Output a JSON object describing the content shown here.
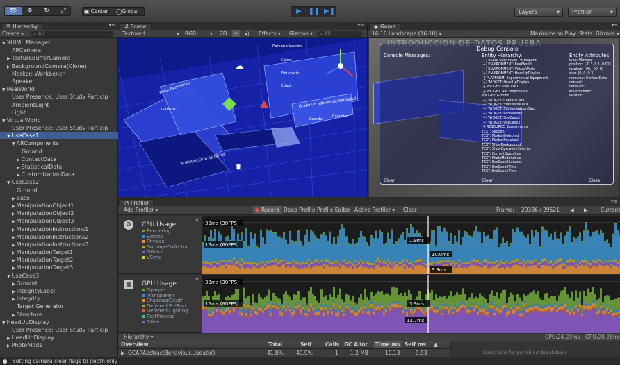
{
  "toolbar": {
    "center": "Center",
    "global": "Global",
    "layers": "Layers",
    "layout": "Profiler"
  },
  "hierarchy": {
    "tab": "Hierarchy",
    "create": "Create",
    "search": "All",
    "items": [
      {
        "label": "XUIML Manager",
        "indent": 0,
        "arrow": "▼",
        "sel": false
      },
      {
        "label": "ARCamera",
        "indent": 2,
        "arrow": "",
        "sel": false
      },
      {
        "label": "TextureBufferCamera",
        "indent": 1,
        "arrow": "▶",
        "sel": false
      },
      {
        "label": "BackgroundCamera(Clone)",
        "indent": 1,
        "arrow": "▶",
        "sel": false
      },
      {
        "label": "Marker: Workbench",
        "indent": 2,
        "arrow": "",
        "sel": false
      },
      {
        "label": "Speaker",
        "indent": 2,
        "arrow": "",
        "sel": false
      },
      {
        "label": "RealWorld",
        "indent": 0,
        "arrow": "▼",
        "sel": false
      },
      {
        "label": "User Presence: User Study Particip",
        "indent": 2,
        "arrow": "",
        "sel": false
      },
      {
        "label": "AmbientLight",
        "indent": 2,
        "arrow": "",
        "sel": false
      },
      {
        "label": "Light",
        "indent": 2,
        "arrow": "",
        "sel": false
      },
      {
        "label": "VirtualWorld",
        "indent": 0,
        "arrow": "▼",
        "sel": false
      },
      {
        "label": "User Presence: User Study Particip",
        "indent": 2,
        "arrow": "",
        "sel": false
      },
      {
        "label": "UseCase1",
        "indent": 1,
        "arrow": "▼",
        "sel": true
      },
      {
        "label": "ARComponents",
        "indent": 2,
        "arrow": "▼",
        "sel": false
      },
      {
        "label": "Ground",
        "indent": 4,
        "arrow": "",
        "sel": false
      },
      {
        "label": "ContactData",
        "indent": 3,
        "arrow": "▶",
        "sel": false
      },
      {
        "label": "StatisticalData",
        "indent": 3,
        "arrow": "▶",
        "sel": false
      },
      {
        "label": "CustomizationData",
        "indent": 3,
        "arrow": "▶",
        "sel": false
      },
      {
        "label": "UseCase2",
        "indent": 1,
        "arrow": "▼",
        "sel": false
      },
      {
        "label": "Ground",
        "indent": 3,
        "arrow": "",
        "sel": false
      },
      {
        "label": "Base",
        "indent": 2,
        "arrow": "▶",
        "sel": false
      },
      {
        "label": "ManipulationObject1",
        "indent": 2,
        "arrow": "▶",
        "sel": false
      },
      {
        "label": "ManipulationObject2",
        "indent": 2,
        "arrow": "▶",
        "sel": false
      },
      {
        "label": "ManipulationObject3",
        "indent": 2,
        "arrow": "▶",
        "sel": false
      },
      {
        "label": "ManipulationInstructions1",
        "indent": 2,
        "arrow": "▶",
        "sel": false
      },
      {
        "label": "ManipulationInstructions2",
        "indent": 2,
        "arrow": "▶",
        "sel": false
      },
      {
        "label": "ManipulationInstructions3",
        "indent": 2,
        "arrow": "▶",
        "sel": false
      },
      {
        "label": "ManipulationTarget1",
        "indent": 2,
        "arrow": "▶",
        "sel": false
      },
      {
        "label": "ManipulationTarget2",
        "indent": 2,
        "arrow": "▶",
        "sel": false
      },
      {
        "label": "ManipulationTarget3",
        "indent": 2,
        "arrow": "▶",
        "sel": false
      },
      {
        "label": "UseCase3",
        "indent": 1,
        "arrow": "▼",
        "sel": false
      },
      {
        "label": "Ground",
        "indent": 2,
        "arrow": "▶",
        "sel": false
      },
      {
        "label": "IntegrityLabel",
        "indent": 2,
        "arrow": "▶",
        "sel": false
      },
      {
        "label": "Integrity",
        "indent": 2,
        "arrow": "▶",
        "sel": false
      },
      {
        "label": "Target Generator",
        "indent": 3,
        "arrow": "",
        "sel": false
      },
      {
        "label": "Structure",
        "indent": 2,
        "arrow": "▶",
        "sel": false
      },
      {
        "label": "HeadUpDisplay",
        "indent": 0,
        "arrow": "▼",
        "sel": false
      },
      {
        "label": "User Presence: User Study Particip",
        "indent": 2,
        "arrow": "",
        "sel": false
      },
      {
        "label": "HeadUpDisplay",
        "indent": 1,
        "arrow": "▶",
        "sel": false
      },
      {
        "label": "PhotoMode",
        "indent": 1,
        "arrow": "▶",
        "sel": false
      }
    ]
  },
  "scene": {
    "tab": "Scene",
    "shading": "Textured",
    "rgb": "RGB",
    "mode2d": "2D",
    "effects": "Effects",
    "gizmos": "Gizmos",
    "search": "All",
    "labels": [
      "Personalización",
      "Color:",
      "Datos Estadísticos",
      "Género:",
      "Fiduciario:",
      "Edad:",
      "Grabe un estudio de fiabilidad",
      "Guardar",
      "Cancelar",
      "INTRODUCCIÓN DE DATOS"
    ]
  },
  "game": {
    "tab": "Game",
    "aspect": "16:10 Landscape (16:10)",
    "maximize": "Maximize on Play",
    "stats": "Stats",
    "gizmos": "Gizmos",
    "title": "INTRODUCCIÓN DE DATOS PRUEBA",
    "console_title": "Debug Console",
    "console_messages": "Console Messages:",
    "entity_hierarchy": "Entity Hierarchy:",
    "entity_attributes": "Entity Attributes:",
    "hierarchy_lines": [
      "[+] USER: User Study Participant",
      "[+] ENVIRONMENT: RealWorld",
      "[+] ENVIRONMENT: VirtualWorld",
      "[+] ENVIRONMENT: HeadUpDisplay",
      "[-] PLATFORM: Experimental Equipment",
      "[+] WIDGET: HeadUpDisplay",
      "[-] WIDGET: UseCase1",
      "[-] WIDGET: ARComponents",
      "WIDGET: Ground",
      "[+] WIDGET: ContactData",
      "[+] WIDGET: StatisticalData",
      "[+] WIDGET: CustomizationData",
      "[+] WIDGET: PhotoMode",
      "[+] WIDGET: UseCase2",
      "[+] WIDGET: UseCase3",
      "[-] RESOURCE: Experiments",
      "TEXT: Section",
      "TEXT: MarkerDetected",
      "TEXT: MarkerRequired",
      "TEXT: ShowBackground",
      "TEXT: ShowOperationSelector",
      "TEXT: CurrentOperation",
      "TEXT: PhotoModeActive",
      "TEXT: UseCase0Success",
      "TEXT: UseCase0Time",
      "TEXT: UseCase1Time"
    ],
    "attribute_lines": [
      "type: Window",
      "position: [-0.3, 0.1, 0.02]",
      "rotation: [90, -90, 0]",
      "size: [0, 0, 0.3]",
      "resource: ContactData",
      "context:",
      "behavior:",
      "environment:",
      "location:"
    ],
    "clear": "Clear",
    "close": "Close"
  },
  "profiler": {
    "tab": "Profiler",
    "add": "Add Profiler",
    "record": "Record",
    "deep": "Deep Profile",
    "editor": "Profile Editor",
    "active": "Active Profiler",
    "clear": "Clear",
    "frame_label": "Frame:",
    "frame": "29386 / 29521",
    "current": "Current",
    "cpu": {
      "title": "CPU Usage",
      "legend": [
        {
          "name": "Rendering",
          "color": "#6ea23a"
        },
        {
          "name": "Scripts",
          "color": "#3b8ec9"
        },
        {
          "name": "Physics",
          "color": "#e0913a"
        },
        {
          "name": "GarbageCollector",
          "color": "#b7a23b"
        },
        {
          "name": "Others",
          "color": "#8a5cc7"
        },
        {
          "name": "VSync",
          "color": "#d6c93a"
        }
      ],
      "lines": [
        "33ms (30FPS)",
        "16ms (60FPS)"
      ],
      "markers": [
        "1.9ms",
        "10.0ms",
        "3.9ms"
      ]
    },
    "gpu": {
      "title": "GPU Usage",
      "legend": [
        {
          "name": "Opaque",
          "color": "#6ea23a"
        },
        {
          "name": "Transparent",
          "color": "#3b8ec9"
        },
        {
          "name": "Shadows/Depth",
          "color": "#e0913a"
        },
        {
          "name": "Deferred PrePass",
          "color": "#b7a23b"
        },
        {
          "name": "Deferred Lighting",
          "color": "#c46a3a"
        },
        {
          "name": "PostProcess",
          "color": "#3bb7a8"
        },
        {
          "name": "Other",
          "color": "#8a5cc7"
        }
      ],
      "lines": [
        "33ms (30FPS)",
        "16ms (60FPS)"
      ],
      "markers": [
        "5.9ms",
        "13.7ms"
      ]
    },
    "hier_mode": "Hierarchy",
    "cpu_stat": "CPU:24.23ms",
    "gpu_stat": "GPU:20.28ms",
    "columns": [
      "Overview",
      "Total",
      "Self",
      "Calls",
      "GC Alloc",
      "Time ms",
      "Self ms"
    ],
    "row": [
      "QCARAbstractBehaviour.Update()",
      "41.8%",
      "40.9%",
      "1",
      "1.2 MB",
      "10.13",
      "9.93"
    ],
    "detail": "Select Line for per-object breakdown"
  },
  "status": "Setting camera clear flags to depth only"
}
